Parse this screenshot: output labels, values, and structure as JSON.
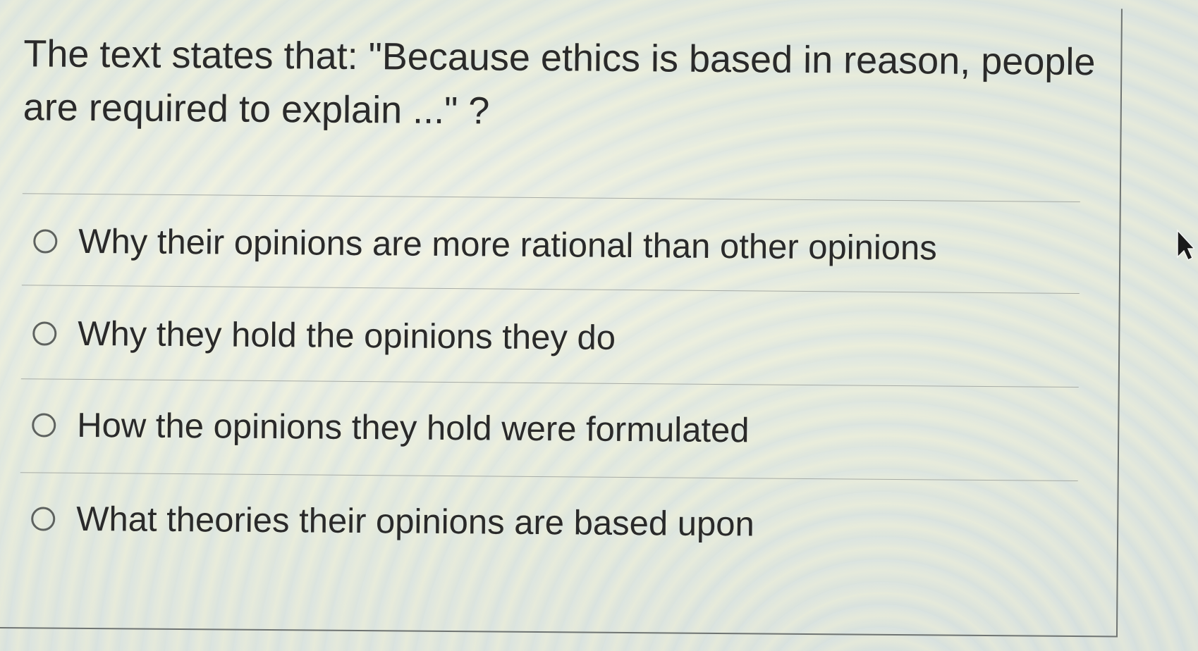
{
  "question": {
    "text": "The text states that: \"Because ethics is based in reason, people are required to explain ...\" ?"
  },
  "options": [
    {
      "label": "Why their opinions are more rational than other opinions",
      "selected": false
    },
    {
      "label": "Why they hold the opinions they do",
      "selected": false
    },
    {
      "label": "How the opinions they hold were formulated",
      "selected": false
    },
    {
      "label": "What theories their opinions are based upon",
      "selected": false
    }
  ],
  "icons": {
    "radio": "radio-unchecked-icon",
    "cursor": "mouse-pointer-icon"
  }
}
